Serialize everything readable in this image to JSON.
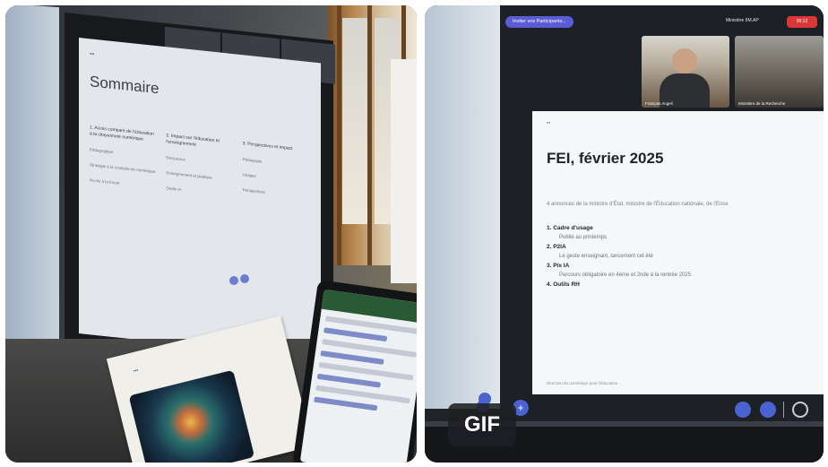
{
  "left_photo": {
    "slide": {
      "title": "Sommaire",
      "columns": [
        {
          "heading": "1. Accès comparé de l'éducation à la citoyenneté numérique",
          "items": [
            "Pédagogique",
            "Stratégie à la conduite du numérique",
            "Accès à la forum"
          ]
        },
        {
          "heading": "2. Impact sur l'éducation et l'enseignement",
          "items": [
            "Ressource",
            "Enseignement et pratique",
            "Outils IA"
          ]
        },
        {
          "heading": "3. Perspectives et impact",
          "items": [
            "Pédagogie",
            "Usages",
            "Perspectives"
          ]
        }
      ]
    }
  },
  "right_photo": {
    "invite_label": "Inviter vos Participants...",
    "room_name": "Ministère IIM.AP",
    "record_label": "00:12",
    "participants": [
      "François Angeli",
      "Ministère de la Recherche"
    ],
    "slide": {
      "title": "FEI, février 2025",
      "subtitle": "4 annonces de la ministre d'État, ministre de l'Éducation nationale, de l'Ense",
      "items": [
        {
          "label": "1. Cadre d'usage",
          "sub": "Publié au printemps"
        },
        {
          "label": "2. P2IA",
          "sub": "Le geste enseignant, lancement cet été"
        },
        {
          "label": "3. Pix IA",
          "sub": "Parcours obligatoire en 4ème et 2nde à la rentrée 2025"
        },
        {
          "label": "4. Outils RH",
          "sub": ""
        }
      ],
      "footer": "Direction du numérique pour l'éducation"
    }
  },
  "gif_badge": "GIF"
}
